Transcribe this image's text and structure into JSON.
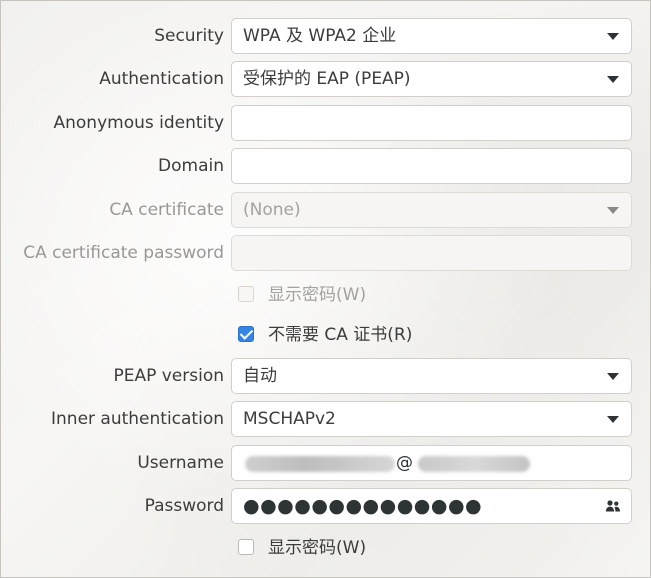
{
  "form": {
    "security": {
      "label": "Security",
      "value": "WPA 及 WPA2 企业"
    },
    "authentication": {
      "label": "Authentication",
      "value": "受保护的 EAP (PEAP)"
    },
    "anonymous_identity": {
      "label": "Anonymous identity",
      "value": ""
    },
    "domain": {
      "label": "Domain",
      "value": ""
    },
    "ca_certificate": {
      "label": "CA certificate",
      "value": "(None)"
    },
    "ca_certificate_password": {
      "label": "CA certificate password",
      "value": ""
    },
    "show_password_ca": {
      "label": "显示密码(W)",
      "checked": false
    },
    "no_ca_required": {
      "label": "不需要 CA 证书(R)",
      "checked": true
    },
    "peap_version": {
      "label": "PEAP version",
      "value": "自动"
    },
    "inner_authentication": {
      "label": "Inner authentication",
      "value": "MSCHAPv2"
    },
    "username": {
      "label": "Username",
      "visible_fragment": "@"
    },
    "password": {
      "label": "Password",
      "value": "●●●●●●●●●●●●●●"
    },
    "show_password": {
      "label": "显示密码(W)",
      "checked": false
    }
  },
  "icons": {
    "dropdown": "chevron-down-icon",
    "password_peek": "user-menu-icon"
  },
  "colors": {
    "accent": "#3584e4",
    "label": "#3c3c3c",
    "disabled_label": "#9a9896"
  }
}
